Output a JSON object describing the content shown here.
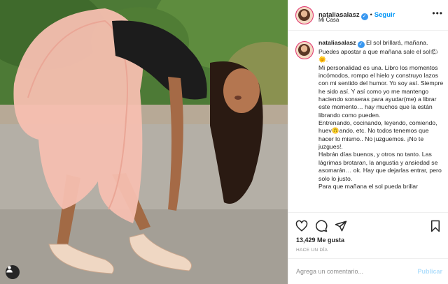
{
  "post": {
    "username": "nataliasalasz",
    "verified_icon": "verified-badge-icon",
    "follow_label": "Seguir",
    "location": "Mi Casa",
    "more_icon": "more-options-icon",
    "caption": "El sol brillará, mañana. Puedes apostar a que mañana sale el sol🌤🌞.\nMi personalidad es una. Libro los momentos incómodos, rompo el hielo y construyo lazos con mi sentido del humor. Yo soy así. Siempre he sido así. Y así como yo me mantengo haciendo sonseras para ayudar(me) a librar este momento… hay muchos que la están librando como pueden.\nEntrenando, cocinando, leyendo, comiendo, huev🙃ando, etc. No todos tenemos que hacer lo mismo.. No juzguemos. ¡No te juzgues!.\nHabrán días buenos, y otros no tanto. Las lágrimas brotaran, la angustia y ansiedad se asomarán… ok. Hay que dejarlas entrar, pero solo lo justo.\nPara que mañana el sol pueda brillar",
    "likes_count": "13,429",
    "likes_label": "Me gusta",
    "time_ago": "HACE UN DÍA",
    "comment_placeholder": "Agrega un comentario...",
    "publish_label": "Publicar"
  },
  "icons": {
    "like": "heart-icon",
    "comment": "comment-icon",
    "share": "share-icon",
    "save": "bookmark-icon",
    "tag": "user-tag-icon"
  },
  "colors": {
    "link_blue": "#0095f6",
    "publish_disabled": "#b2dffc",
    "muted_text": "#8e8e8e",
    "verified_blue": "#3897f0"
  }
}
